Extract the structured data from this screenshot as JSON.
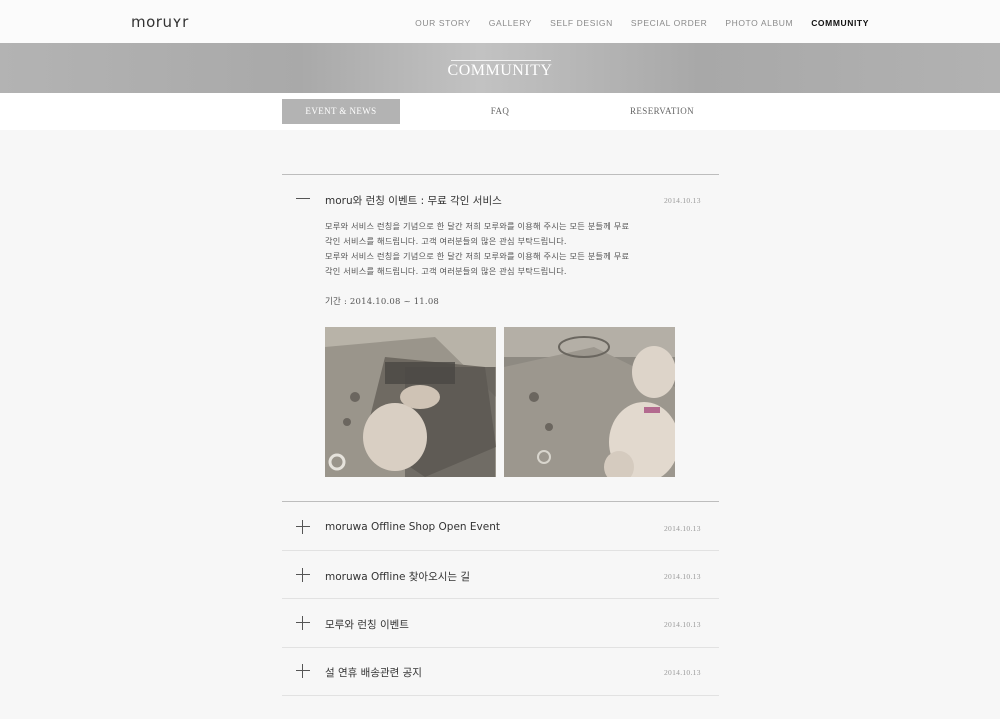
{
  "header": {
    "logo": "moruʏr",
    "nav": [
      "OUR STORY",
      "GALLERY",
      "SELF DESIGN",
      "SPECIAL ORDER",
      "PHOTO ALBUM",
      "COMMUNITY"
    ],
    "active_nav": "COMMUNITY"
  },
  "banner": {
    "title": "COMMUNITY"
  },
  "tabs": [
    "EVENT & NEWS",
    "FAQ",
    "RESERVATION"
  ],
  "active_tab": "EVENT & NEWS",
  "expanded_item": {
    "title": "moru와 런칭 이벤트 : 무료 각인 서비스",
    "date": "2014.10.13",
    "body": [
      "모루와 서비스 런칭을 기념으로 한 달간 저희 모루와를 이용해 주시는 모든 분들께 무료",
      "각인 서비스를 해드립니다. 고객 여러분들의 많은 관심 부탁드립니다.",
      "모루와 서비스 런칭을 기념으로 한 달간 저희 모루와를 이용해 주시는 모든 분들께 무료",
      "각인 서비스를 해드립니다. 고객 여러분들의 많은 관심 부탁드립니다."
    ],
    "period": "기간 : 2014.10.08 ~ 11.08"
  },
  "items": [
    {
      "title": "moruwa Offline Shop Open Event",
      "date": "2014.10.13"
    },
    {
      "title": "moruwa Offline 찾아오시는 길",
      "date": "2014.10.13"
    },
    {
      "title": "모루와 런칭 이벤트",
      "date": "2014.10.13"
    },
    {
      "title": "설 연휴 배송관련 공지",
      "date": "2014.10.13"
    }
  ],
  "colors": {
    "accent": "#b3b3b3",
    "background": "#f7f7f7",
    "text": "#333333"
  }
}
